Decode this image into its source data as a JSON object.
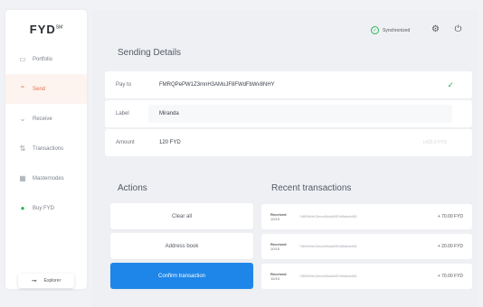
{
  "sidebar": {
    "logo": "FYD",
    "logo_mark": "SM",
    "items": [
      {
        "label": "Portfolio",
        "icon": "folder-icon",
        "glyph": "▭"
      },
      {
        "label": "Send",
        "icon": "arrow-up-icon",
        "glyph": "⌃"
      },
      {
        "label": "Receive",
        "icon": "arrow-down-icon",
        "glyph": "⌄"
      },
      {
        "label": "Transactions",
        "icon": "transfer-icon",
        "glyph": "⇅"
      },
      {
        "label": "Masternodes",
        "icon": "grid-icon",
        "glyph": "▦"
      },
      {
        "label": "Buy FYD",
        "icon": "buy-dot-icon",
        "glyph": "●"
      }
    ],
    "explorer": {
      "label": "Explorer",
      "glyph": "⊸"
    }
  },
  "topbar": {
    "status": "Synchronized",
    "sync_glyph": "✓",
    "settings_glyph": "⚙",
    "power_glyph": "⏻"
  },
  "sending": {
    "title": "Sending Details",
    "pay_to_label": "Pay to",
    "pay_to_value": "FMRQPePW1Z3mnH3AMoJF8FWdFbWv8NHY",
    "label_label": "Label",
    "label_value": "Miranda",
    "amount_label": "Amount",
    "amount_value": "120 FYD",
    "amount_extra": "1420.0 FYD"
  },
  "actions": {
    "title": "Actions",
    "clear_all": "Clear all",
    "address_book": "Address book",
    "confirm": "Confirm transaction"
  },
  "recent": {
    "title": "Recent transactions",
    "items": [
      {
        "status": "Received",
        "date": "10/15",
        "hash": "7d8f2fe9fe13ecce5bdda2f87e8fafa4e681",
        "amount": "+ 70.00 FYD"
      },
      {
        "status": "Received",
        "date": "10/15",
        "hash": "7d8f2fe9fe13ecce5bdda2f87e8fafa4e681",
        "amount": "+ 20.00 FYD"
      },
      {
        "status": "Received",
        "date": "10/15",
        "hash": "7d8f2fe9fe13ecce5bdda2f87e8fafa4e681",
        "amount": "+ 70.00 FYD"
      }
    ]
  },
  "colors": {
    "accent": "#e4744c",
    "primary": "#1e86e8",
    "success": "#2fb553"
  }
}
